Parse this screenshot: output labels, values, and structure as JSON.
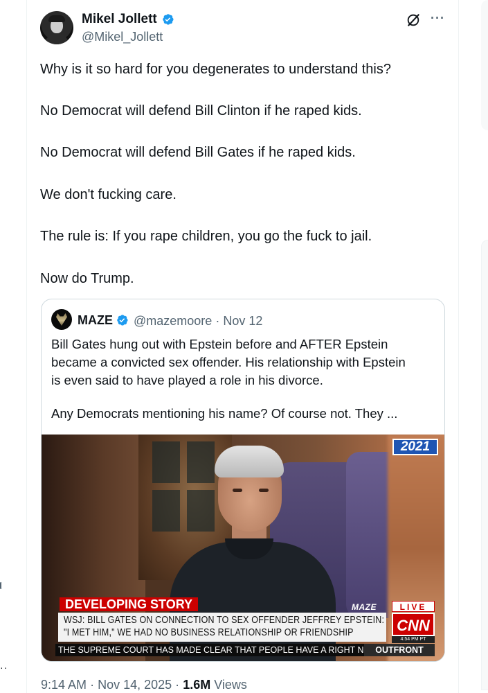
{
  "author": {
    "name": "Mikel Jollett",
    "handle": "@Mikel_Jollett",
    "verified": true,
    "avatar_icon": "avatar-photo"
  },
  "header_actions": {
    "grok_icon": "grok-icon",
    "more_icon": "more-icon",
    "more_glyph": "···"
  },
  "tweet": {
    "lines": [
      "Why is it so hard for you degenerates to understand this?",
      "No Democrat will defend Bill Clinton if he raped kids.",
      "No Democrat will defend Bill Gates if he raped kids.",
      "We don't fucking care.",
      "The rule is: If you rape children, you go the fuck to jail.",
      "Now do Trump."
    ]
  },
  "quote": {
    "name": "MAZE",
    "handle": "@mazemoore",
    "separator": "·",
    "date": "Nov 12",
    "verified": true,
    "text_lines": [
      "Bill Gates hung out with Epstein before and AFTER Epstein",
      "became a convicted sex offender. His relationship with Epstein",
      "is even said to have played a role in his divorce.",
      "Any Democrats mentioning his name? Of course not. They ..."
    ],
    "media": {
      "year_badge": "2021",
      "developing": "DEVELOPING STORY",
      "watermark": "MAZE",
      "live": "LIVE",
      "headline_1": "WSJ: BILL GATES ON CONNECTION TO SEX OFFENDER JEFFREY EPSTEIN:",
      "headline_2": "\"I MET HIM,\" WE HAD NO BUSINESS RELATIONSHIP OR FRIENDSHIP",
      "network": "CNN",
      "time": "4:54 PM PT",
      "ticker": "THE SUPREME COURT HAS MADE CLEAR THAT PEOPLE HAVE A RIGHT NOT T",
      "show": "OUTFRONT"
    }
  },
  "meta": {
    "time": "9:14 AM",
    "sep1": "·",
    "date": "Nov 14, 2025",
    "sep2": "·",
    "views": "1.6M",
    "views_label": "Views"
  },
  "colors": {
    "verified_blue": "#1d9bf0",
    "secondary_text": "#536471",
    "primary_text": "#0f1419",
    "border": "#cfd9de"
  }
}
